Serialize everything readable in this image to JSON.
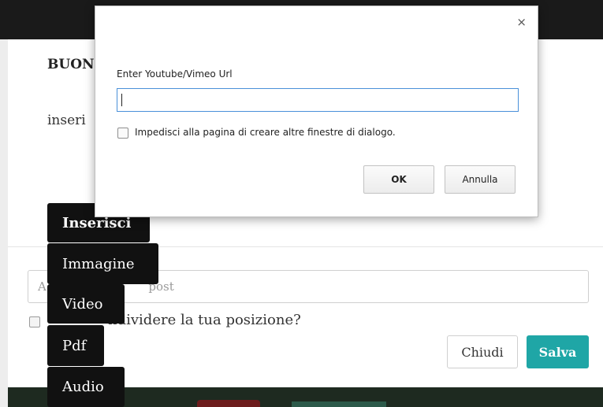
{
  "page": {
    "heading": "BUON",
    "subtext": "inseri",
    "post_placeholder_visible_start": "A",
    "post_placeholder_visible_end": "post",
    "position_question": "ndividere la tua posizione?",
    "close_label": "Chiudi",
    "save_label": "Salva",
    "accent_color": "#1fa6a6"
  },
  "menu": {
    "items": [
      {
        "label": "Inserisci"
      },
      {
        "label": "Immagine"
      },
      {
        "label": "Video"
      },
      {
        "label": "Pdf"
      },
      {
        "label": "Audio"
      }
    ]
  },
  "dialog": {
    "close_glyph": "×",
    "message": "Enter Youtube/Vimeo Url",
    "input_value": "",
    "suppress_label": "Impedisci alla pagina di creare altre finestre di dialogo.",
    "ok_label": "OK",
    "cancel_label": "Annulla"
  }
}
